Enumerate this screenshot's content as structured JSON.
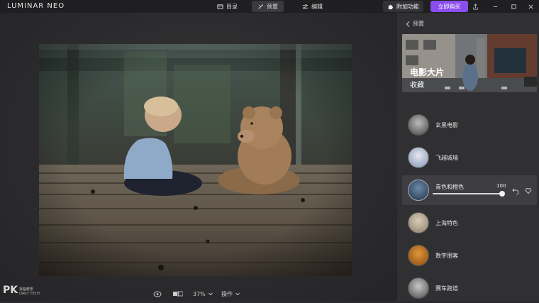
{
  "app": {
    "logo": "LUMINAR NEO"
  },
  "nav": {
    "catalog": "目录",
    "presets": "预置",
    "edit": "编辑"
  },
  "toolbar": {
    "addons": "附加功能",
    "buy": "立即购买"
  },
  "canvas": {
    "zoom": "37%",
    "actions": "操作"
  },
  "watermark": {
    "text": "PK",
    "sub1": "電腦教學",
    "sub2": "DAILY TECH"
  },
  "panel": {
    "back_label": "预置",
    "collection_title": "电影大片",
    "collection_subtitle": "收藏",
    "presets": [
      {
        "label": "玄黑电影"
      },
      {
        "label": "飞越城墙"
      },
      {
        "label": "青色和橙色",
        "amount": "100",
        "amount_fraction": 1.0
      },
      {
        "label": "上海特色"
      },
      {
        "label": "数字朋客"
      },
      {
        "label": "赛车跑道"
      }
    ]
  },
  "colors": {
    "accent": "#8a4ef0",
    "panel_bg": "#303033",
    "titlebar_bg": "#1f1f21"
  },
  "icons": [
    "catalog-icon",
    "presets-icon",
    "edit-icon",
    "puzzle-icon",
    "share-icon",
    "minimize-icon",
    "maximize-icon",
    "close-icon",
    "eye-icon",
    "compare-icon",
    "chevron-down-icon",
    "chevron-left-icon",
    "undo-icon",
    "heart-icon"
  ]
}
